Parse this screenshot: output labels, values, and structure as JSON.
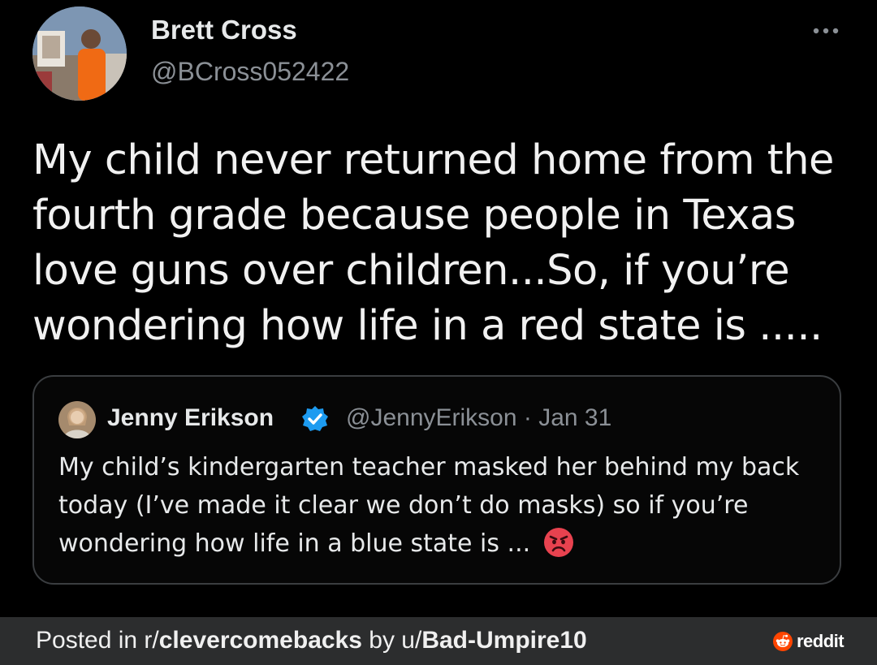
{
  "tweet": {
    "author_name": "Brett Cross",
    "author_handle": "@BCross052422",
    "more_icon": "more-horizontal-icon",
    "text": "My child never returned home from the fourth grade because people in Texas love guns over children...So, if you’re wondering how life in a red state is .....",
    "quoted": {
      "author_name": "Jenny Erikson",
      "verified_icon": "verified-badge-icon",
      "meta": "@JennyErikson · Jan 31",
      "text": "My child’s kindergarten teacher masked her behind my back today (I’ve made it clear we don’t do masks) so if you’re wondering how life in a blue state is ...",
      "emoji_icon": "angry-face-emoji-icon"
    }
  },
  "footer": {
    "prefix": "Posted in r/",
    "subreddit": "clevercomebacks",
    "by": " by u/",
    "user": "Bad-Umpire10",
    "brand": "reddit"
  },
  "colors": {
    "background": "#000000",
    "footer_bg": "#2c2d2e",
    "verified_blue": "#1d9bf0",
    "reddit_orange": "#ff4500",
    "muted_text": "#8b9096"
  }
}
